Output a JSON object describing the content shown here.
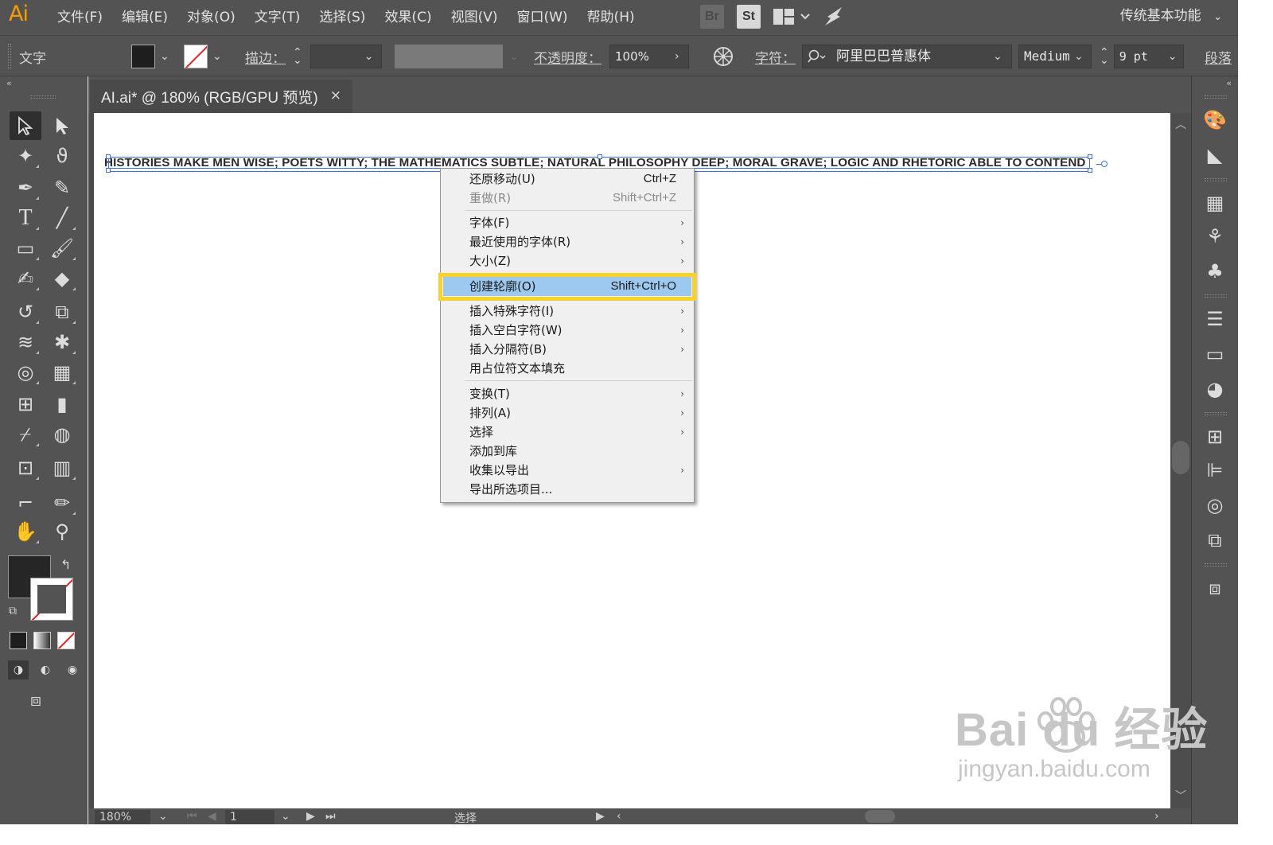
{
  "app": {
    "logo": "Ai"
  },
  "menubar": {
    "items": [
      "文件(F)",
      "编辑(E)",
      "对象(O)",
      "文字(T)",
      "选择(S)",
      "效果(C)",
      "视图(V)",
      "窗口(W)",
      "帮助(H)"
    ],
    "bridge_label": "Br",
    "stock_label": "St",
    "workspace": "传统基本功能"
  },
  "controlbar": {
    "tool_name": "文字",
    "stroke_label": "描边：",
    "opacity_label": "不透明度：",
    "opacity_value": "100%",
    "char_label": "字符：",
    "font_family": "阿里巴巴普惠体",
    "font_style": "Medium",
    "font_size": "9 pt",
    "paragraph_label": "段落"
  },
  "document": {
    "tab_title": "AI.ai* @ 180% (RGB/GPU 预览)",
    "close": "×",
    "text_content": "HISTORIES MAKE MEN WISE; POETS WITTY; THE MATHEMATICS SUBTLE; NATURAL PHILOSOPHY DEEP; MORAL GRAVE; LOGIC AND RHETORIC ABLE TO CONTEND"
  },
  "statusbar": {
    "zoom": "180%",
    "page": "1",
    "mode": "选择"
  },
  "context_menu": {
    "items": [
      {
        "label": "还原移动(U)",
        "shortcut": "Ctrl+Z",
        "disabled": false,
        "submenu": false
      },
      {
        "label": "重做(R)",
        "shortcut": "Shift+Ctrl+Z",
        "disabled": true,
        "submenu": false
      },
      {
        "label": "字体(F)",
        "shortcut": "",
        "disabled": false,
        "submenu": true
      },
      {
        "label": "最近使用的字体(R)",
        "shortcut": "",
        "disabled": false,
        "submenu": true
      },
      {
        "label": "大小(Z)",
        "shortcut": "",
        "disabled": false,
        "submenu": true
      },
      {
        "label": "创建轮廓(O)",
        "shortcut": "Shift+Ctrl+O",
        "disabled": false,
        "submenu": false,
        "highlighted": true
      },
      {
        "label": "插入特殊字符(I)",
        "shortcut": "",
        "disabled": false,
        "submenu": true
      },
      {
        "label": "插入空白字符(W)",
        "shortcut": "",
        "disabled": false,
        "submenu": true
      },
      {
        "label": "插入分隔符(B)",
        "shortcut": "",
        "disabled": false,
        "submenu": true
      },
      {
        "label": "用占位符文本填充",
        "shortcut": "",
        "disabled": false,
        "submenu": false
      },
      {
        "label": "变换(T)",
        "shortcut": "",
        "disabled": false,
        "submenu": true
      },
      {
        "label": "排列(A)",
        "shortcut": "",
        "disabled": false,
        "submenu": true
      },
      {
        "label": "选择",
        "shortcut": "",
        "disabled": false,
        "submenu": true
      },
      {
        "label": "添加到库",
        "shortcut": "",
        "disabled": false,
        "submenu": false
      },
      {
        "label": "收集以导出",
        "shortcut": "",
        "disabled": false,
        "submenu": true
      },
      {
        "label": "导出所选项目...",
        "shortcut": "",
        "disabled": false,
        "submenu": false
      }
    ]
  },
  "watermark": {
    "main": "Bai du 经验",
    "sub": "jingyan.baidu.com"
  },
  "colors": {
    "ui_dark": "#535353",
    "highlight_border": "#f7d22a",
    "menu_highlight": "#9dc8f0",
    "selection": "#3d6fd6",
    "logo": "#ff9a00"
  }
}
